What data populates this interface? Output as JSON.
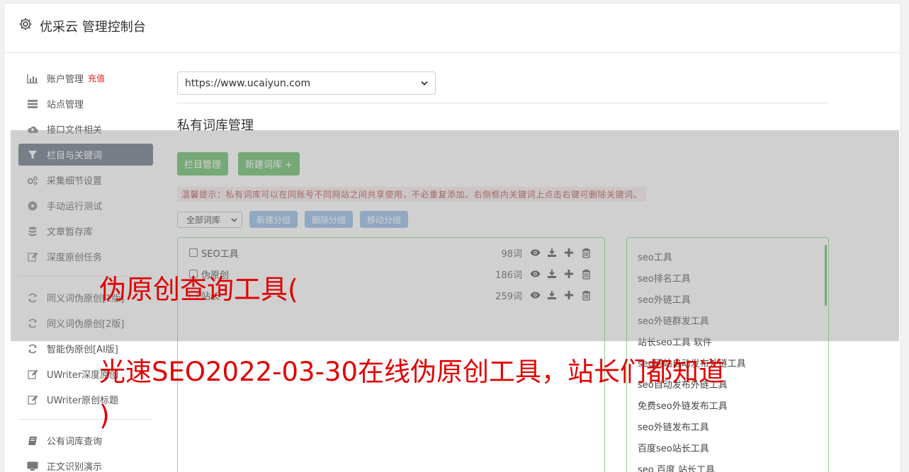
{
  "header": {
    "title": "优采云 管理控制台",
    "icon": "gear-icon"
  },
  "sidebar": {
    "items": [
      {
        "label": "账户管理",
        "icon": "bar-chart-icon",
        "badge": "充值"
      },
      {
        "label": "站点管理",
        "icon": "server-icon"
      },
      {
        "label": "接口文件相关",
        "icon": "cloud-upload-icon"
      },
      {
        "label": "栏目与关键词",
        "icon": "filter-icon",
        "active": true
      },
      {
        "label": "采集细节设置",
        "icon": "cogs-icon"
      },
      {
        "label": "手动运行测试",
        "icon": "play-circle-icon"
      },
      {
        "label": "文章暂存库",
        "icon": "database-icon"
      },
      {
        "label": "深度原创任务",
        "icon": "edit-icon"
      }
    ],
    "items2": [
      {
        "label": "同义词伪原创[1版]",
        "icon": "refresh-icon"
      },
      {
        "label": "同义词伪原创[2版]",
        "icon": "refresh-icon"
      },
      {
        "label": "智能伪原创[AI版]",
        "icon": "refresh-icon"
      },
      {
        "label": "UWriter深度原创",
        "icon": "edit-icon"
      },
      {
        "label": "UWriter原创标题",
        "icon": "edit-icon"
      }
    ],
    "items3": [
      {
        "label": "公有词库查询",
        "icon": "book-icon"
      },
      {
        "label": "正文识别演示",
        "icon": "desktop-icon"
      }
    ]
  },
  "main": {
    "site_select": "https://www.ucaiyun.com",
    "title": "私有词库管理",
    "buttons": {
      "column_manage": "栏目管理",
      "new_library": "新建词库 +"
    },
    "tip": "温馨提示：私有词库可以在同账号不同网站之间共享使用，不必重复添加。右侧框内关键词上点击右键可删除关键词。",
    "filter_select": "全部词库",
    "group_buttons": {
      "new": "新建分组",
      "delete": "删除分组",
      "move": "移动分组"
    },
    "libraries": [
      {
        "name": "SEO工具",
        "count": "98词"
      },
      {
        "name": "伪原创",
        "count": "186词"
      },
      {
        "name": "站长",
        "count": "259词"
      }
    ],
    "keywords": [
      "seo工具",
      "seo排名工具",
      "seo外链工具",
      "seo外链群发工具",
      "站长seo工具 软件",
      "seo网站自动发布外链工具",
      "seo自动发布外链工具",
      "免费seo外链发布工具",
      "seo外链发布工具",
      "百度seo站长工具",
      "seo 百度 站长工具"
    ]
  },
  "overlay": {
    "line1": "伪原创查询工具(",
    "line2": "光速SEO2022-03-30在线伪原创工具，站长们都知道",
    "line3": ")"
  },
  "colors": {
    "active_bg": "#5d6a7d",
    "green": "#5cb85c",
    "blue": "#8bb7e4",
    "overlay_red": "#e00000"
  }
}
